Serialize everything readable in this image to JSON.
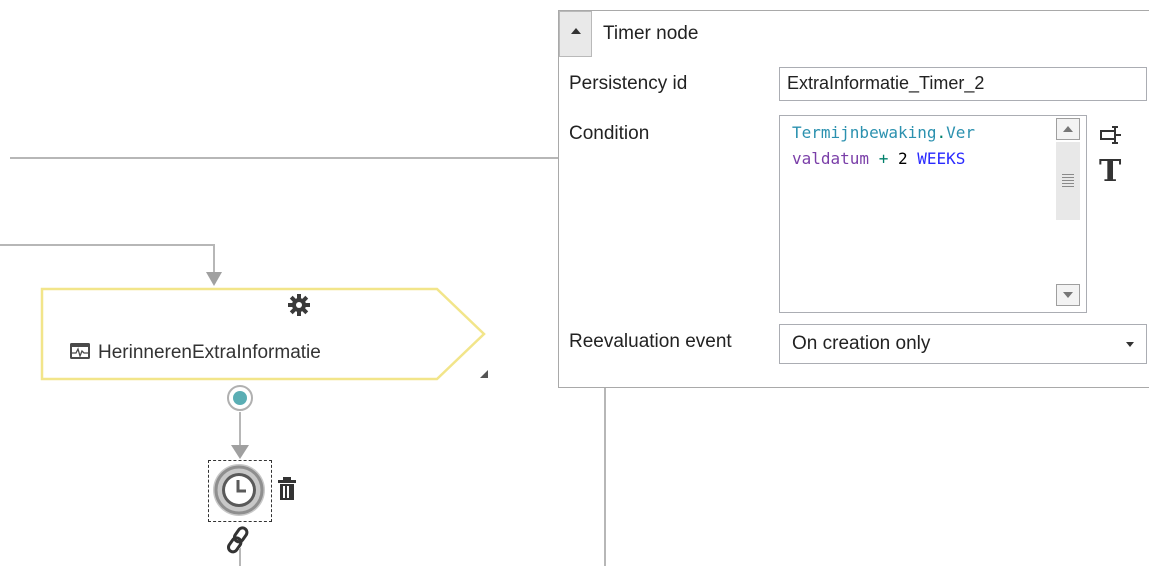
{
  "canvas": {
    "action_node": {
      "label": "HerinnerenExtraInformatie",
      "icon": "window-activity-icon",
      "type_icon": "gear-icon",
      "border_color": "#f2e58a"
    },
    "timer_node": {
      "icon": "clock-icon",
      "delete_icon": "trash-icon",
      "link_icon": "link-icon",
      "port_color": "#5aaeb4"
    }
  },
  "panel": {
    "title": "Timer node",
    "collapse_icon": "caret-up-icon",
    "persistency_label": "Persistency id",
    "persistency_value": "ExtraInformatie_Timer_2",
    "condition_label": "Condition",
    "condition_code": {
      "line1_part1": "Termijnbewaking",
      "line1_part2": ".",
      "line1_part3": "Ver",
      "line2_part1": "valdatum",
      "line2_part2": " + ",
      "line2_part3": "2",
      "line2_part4": " WEEKS"
    },
    "tool_icons": [
      "expression-editor-icon",
      "text-format-icon"
    ],
    "tool_text": "T",
    "reevaluation_label": "Reevaluation event",
    "reevaluation_value": "On creation only"
  }
}
